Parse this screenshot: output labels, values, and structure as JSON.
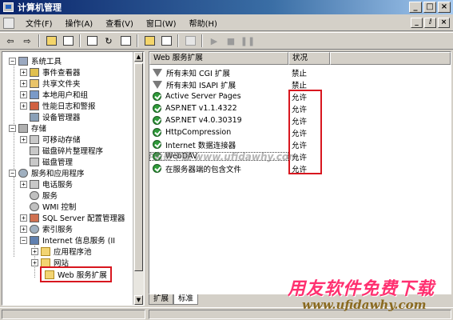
{
  "window": {
    "title": "计算机管理",
    "buttons": [
      "_",
      "□",
      "×"
    ]
  },
  "menubar": {
    "items": [
      "文件(F)",
      "操作(A)",
      "查看(V)",
      "窗口(W)",
      "帮助(H)"
    ],
    "sub_buttons": [
      "_",
      "ⅈ",
      "×"
    ]
  },
  "toolbar": {
    "buttons": [
      "back-icon",
      "forward-icon",
      "up-folder-icon",
      "show-tree-icon",
      "properties-icon",
      "refresh-icon",
      "help-icon",
      "export-icon",
      "connect-icon",
      "play-icon",
      "stop-icon",
      "pause-icon"
    ]
  },
  "tree": {
    "items": [
      {
        "label": "系统工具",
        "icon": "tools-icon"
      },
      {
        "label": "事件查看器",
        "icon": "event-viewer-icon"
      },
      {
        "label": "共享文件夹",
        "icon": "shared-folder-icon"
      },
      {
        "label": "本地用户和组",
        "icon": "users-icon"
      },
      {
        "label": "性能日志和警报",
        "icon": "performance-icon"
      },
      {
        "label": "设备管理器",
        "icon": "device-manager-icon"
      },
      {
        "label": "存储",
        "icon": "storage-icon"
      },
      {
        "label": "可移动存储",
        "icon": "removable-storage-icon"
      },
      {
        "label": "磁盘碎片整理程序",
        "icon": "defrag-icon"
      },
      {
        "label": "磁盘管理",
        "icon": "disk-management-icon"
      },
      {
        "label": "服务和应用程序",
        "icon": "services-apps-icon"
      },
      {
        "label": "电话服务",
        "icon": "telephony-icon"
      },
      {
        "label": "服务",
        "icon": "services-icon"
      },
      {
        "label": "WMI 控制",
        "icon": "wmi-icon"
      },
      {
        "label": "SQL Server 配置管理器",
        "icon": "sql-server-icon"
      },
      {
        "label": "索引服务",
        "icon": "indexing-icon"
      },
      {
        "label": "Internet 信息服务 (II",
        "icon": "iis-icon"
      },
      {
        "label": "应用程序池",
        "icon": "folder-icon"
      },
      {
        "label": "网站",
        "icon": "folder-icon"
      },
      {
        "label": "Web 服务扩展",
        "icon": "folder-icon"
      }
    ]
  },
  "list": {
    "columns": [
      "Web 服务扩展",
      "状况"
    ],
    "rows": [
      {
        "name": "所有未知 CGI 扩展",
        "status": "禁止",
        "icon": "filter-icon"
      },
      {
        "name": "所有未知 ISAPI 扩展",
        "status": "禁止",
        "icon": "filter-icon"
      },
      {
        "name": "Active Server Pages",
        "status": "允许",
        "icon": "allowed-extension-icon"
      },
      {
        "name": "ASP.NET v1.1.4322",
        "status": "允许",
        "icon": "allowed-extension-icon"
      },
      {
        "name": "ASP.NET v4.0.30319",
        "status": "允许",
        "icon": "allowed-extension-icon"
      },
      {
        "name": "HttpCompression",
        "status": "允许",
        "icon": "allowed-extension-icon"
      },
      {
        "name": "Internet 数据连接器",
        "status": "允许",
        "icon": "allowed-extension-icon"
      },
      {
        "name": "WebDAV",
        "status": "允许",
        "icon": "allowed-extension-icon"
      },
      {
        "name": "在服务器端的包含文件",
        "status": "允许",
        "icon": "allowed-extension-icon"
      }
    ]
  },
  "tabs": [
    "扩展",
    "标准"
  ],
  "watermark": {
    "text": "用友软件免费下载 www.ufidawhy.com",
    "promo_cn": "用友软件免费下载",
    "promo_url": "www.ufidawhy.com"
  },
  "colors": {
    "titlebar": "#0a246a",
    "highlight_box": "#d8171f",
    "promo": "#ff3070"
  }
}
